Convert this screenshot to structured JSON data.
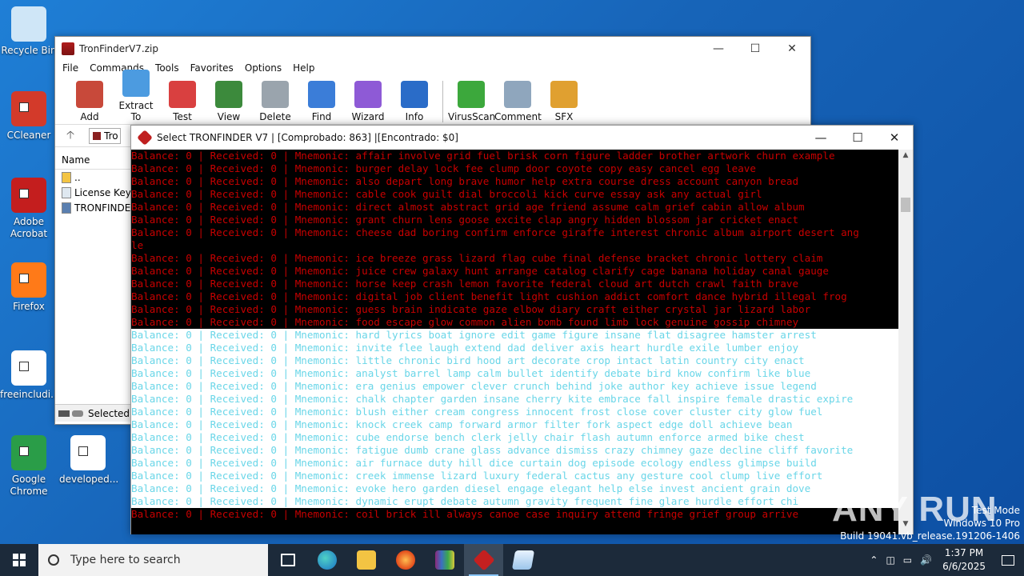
{
  "desktop": {
    "icons": [
      {
        "name": "recycle-bin",
        "label": "Recycle Bin",
        "color": "#cfe6f7"
      },
      {
        "name": "ccleaner",
        "label": "CCleaner",
        "color": "#d33a2a"
      },
      {
        "name": "adobe-acrobat",
        "label": "Adobe Acrobat",
        "color": "#c41e1e"
      },
      {
        "name": "firefox",
        "label": "Firefox",
        "color": "#ff7a18"
      },
      {
        "name": "freeincluding",
        "label": "freeincludi...",
        "color": "#ffffff"
      },
      {
        "name": "google-chrome",
        "label": "Google Chrome",
        "color": "#2a9d48"
      },
      {
        "name": "developed",
        "label": "developed...",
        "color": "#ffffff"
      }
    ]
  },
  "winrar": {
    "title": "TronFinderV7.zip",
    "menu": [
      "File",
      "Commands",
      "Tools",
      "Favorites",
      "Options",
      "Help"
    ],
    "toolbar": [
      {
        "label": "Add",
        "icon": "add-icon",
        "color": "#c8493a"
      },
      {
        "label": "Extract To",
        "icon": "extract-icon",
        "color": "#4c9be0"
      },
      {
        "label": "Test",
        "icon": "test-icon",
        "color": "#d94040"
      },
      {
        "label": "View",
        "icon": "view-icon",
        "color": "#3c8a3c"
      },
      {
        "label": "Delete",
        "icon": "delete-icon",
        "color": "#9aa4ad"
      },
      {
        "label": "Find",
        "icon": "find-icon",
        "color": "#3b7dd8"
      },
      {
        "label": "Wizard",
        "icon": "wizard-icon",
        "color": "#8e5ad6"
      },
      {
        "label": "Info",
        "icon": "info-icon",
        "color": "#2a6cc8"
      },
      {
        "label": "VirusScan",
        "icon": "virusscan-icon",
        "color": "#3ca83c"
      },
      {
        "label": "Comment",
        "icon": "comment-icon",
        "color": "#8fa6bd"
      },
      {
        "label": "SFX",
        "icon": "sfx-icon",
        "color": "#e0a030"
      }
    ],
    "address": "Tro",
    "column_name": "Name",
    "files": [
      {
        "name": "..",
        "type": "folder"
      },
      {
        "name": "License Key.t",
        "type": "text"
      },
      {
        "name": "TRONFINDER",
        "type": "exe"
      }
    ],
    "status": "Selected"
  },
  "console": {
    "title": "Select TRONFINDER V7 | [Comprobado: 863] |[Encontrado: $0]",
    "lines": [
      {
        "c": "red",
        "t": "Balance: 0 | Received: 0 | Mnemonic: affair involve grid fuel brisk corn figure ladder brother artwork churn example"
      },
      {
        "c": "red",
        "t": "Balance: 0 | Received: 0 | Mnemonic: burger delay lock fee clump door coyote copy easy cancel egg leave"
      },
      {
        "c": "red",
        "t": "Balance: 0 | Received: 0 | Mnemonic: also depart long brave humor help extra course dress account canyon bread"
      },
      {
        "c": "red",
        "t": "Balance: 0 | Received: 0 | Mnemonic: cable cook guilt dial broccoli kick curve essay ask any actual girl"
      },
      {
        "c": "red",
        "t": "Balance: 0 | Received: 0 | Mnemonic: direct almost abstract grid age friend assume calm grief cabin allow album"
      },
      {
        "c": "red",
        "t": "Balance: 0 | Received: 0 | Mnemonic: grant churn lens goose excite clap angry hidden blossom jar cricket enact"
      },
      {
        "c": "red",
        "t": "Balance: 0 | Received: 0 | Mnemonic: cheese dad boring confirm enforce giraffe interest chronic album airport desert ang"
      },
      {
        "c": "red",
        "t": "le"
      },
      {
        "c": "red",
        "t": "Balance: 0 | Received: 0 | Mnemonic: ice breeze grass lizard flag cube final defense bracket chronic lottery claim"
      },
      {
        "c": "red",
        "t": "Balance: 0 | Received: 0 | Mnemonic: juice crew galaxy hunt arrange catalog clarify cage banana holiday canal gauge"
      },
      {
        "c": "red",
        "t": "Balance: 0 | Received: 0 | Mnemonic: horse keep crash lemon favorite federal cloud art dutch crawl faith brave"
      },
      {
        "c": "red",
        "t": "Balance: 0 | Received: 0 | Mnemonic: digital job client benefit light cushion addict comfort dance hybrid illegal frog"
      },
      {
        "c": "red",
        "t": "Balance: 0 | Received: 0 | Mnemonic: guess brain indicate gaze elbow diary craft either crystal jar lizard labor"
      },
      {
        "c": "red",
        "t": "Balance: 0 | Received: 0 | Mnemonic: food escape glow common alien bomb found limb lock genuine gossip chimney"
      },
      {
        "c": "cyan",
        "t": "Balance: 0 | Received: 0 | Mnemonic: hard lyrics boat ignore edit game figure insane flat disagree hamster arrest"
      },
      {
        "c": "cyan",
        "t": "Balance: 0 | Received: 0 | Mnemonic: invite flee laugh extend dad deliver axis heart hurdle exile lumber enjoy"
      },
      {
        "c": "cyan",
        "t": "Balance: 0 | Received: 0 | Mnemonic: little chronic bird hood art decorate crop intact latin country city enact"
      },
      {
        "c": "cyan",
        "t": "Balance: 0 | Received: 0 | Mnemonic: analyst barrel lamp calm bullet identify debate bird know confirm like blue"
      },
      {
        "c": "cyan",
        "t": "Balance: 0 | Received: 0 | Mnemonic: era genius empower clever crunch behind joke author key achieve issue legend"
      },
      {
        "c": "cyan",
        "t": "Balance: 0 | Received: 0 | Mnemonic: chalk chapter garden insane cherry kite embrace fall inspire female drastic expire"
      },
      {
        "c": "cyan",
        "t": "Balance: 0 | Received: 0 | Mnemonic: blush either cream congress innocent frost close cover cluster city glow fuel"
      },
      {
        "c": "cyan",
        "t": "Balance: 0 | Received: 0 | Mnemonic: knock creek camp forward armor filter fork aspect edge doll achieve bean"
      },
      {
        "c": "cyan",
        "t": "Balance: 0 | Received: 0 | Mnemonic: cube endorse bench clerk jelly chair flash autumn enforce armed bike chest"
      },
      {
        "c": "cyan",
        "t": "Balance: 0 | Received: 0 | Mnemonic: fatigue dumb crane glass advance dismiss crazy chimney gaze decline cliff favorite"
      },
      {
        "c": "cyan",
        "t": "Balance: 0 | Received: 0 | Mnemonic: air furnace duty hill dice curtain dog episode ecology endless glimpse build"
      },
      {
        "c": "cyan",
        "t": "Balance: 0 | Received: 0 | Mnemonic: creek immense lizard luxury federal cactus any gesture cool clump live effort"
      },
      {
        "c": "cyan",
        "t": "Balance: 0 | Received: 0 | Mnemonic: evoke hero garden diesel engage elegant help else invest ancient grain dove"
      },
      {
        "c": "cyan",
        "t": "Balance: 0 | Received: 0 | Mnemonic: dynamic erupt debate autumn gravity frequent fine glare hurdle effort chi"
      },
      {
        "c": "red",
        "t": "Balance: 0 | Received: 0 | Mnemonic: coil brick ill always canoe case inquiry attend fringe grief group arrive"
      }
    ]
  },
  "watermark": "ANY RUN",
  "testmode": {
    "line1": "Test Mode",
    "line2": "Windows 10 Pro",
    "line3": "Build 19041.vb_release.191206-1406"
  },
  "taskbar": {
    "search_placeholder": "Type here to search",
    "time": "1:37 PM",
    "date": "6/6/2025"
  }
}
